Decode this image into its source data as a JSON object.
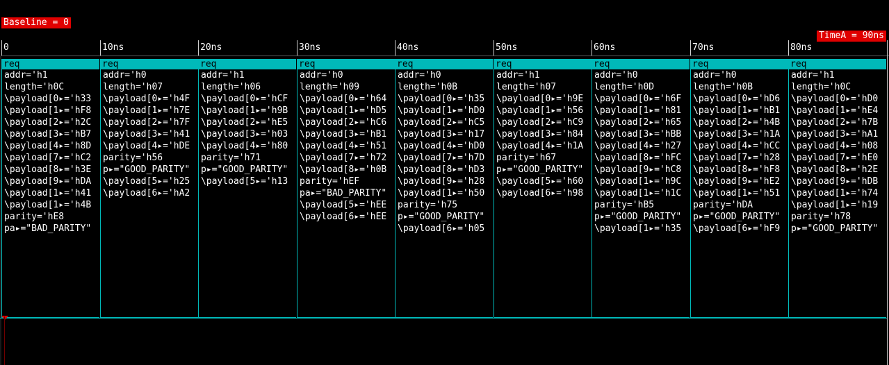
{
  "baseline_label": "Baseline = 0",
  "timea_label": "TimeA = 90ns",
  "ruler_ticks": [
    "0",
    "10ns",
    "20ns",
    "30ns",
    "40ns",
    "50ns",
    "60ns",
    "70ns",
    "80ns"
  ],
  "colors": {
    "background": "#000000",
    "transaction": "#00b9b9",
    "marker": "#e00000",
    "text": "#ffffff"
  },
  "transactions": [
    {
      "label": "req",
      "lines": [
        "addr='h1",
        "length='h0C",
        "\\payload[0▸='h33",
        "\\payload[1▸='hF8",
        "\\payload[2▸='h2C",
        "\\payload[3▸='hB7",
        "\\payload[4▸='h8D",
        "\\payload[7▸='hC2",
        "\\payload[8▸='h3E",
        "\\payload[9▸='hDA",
        "\\payload[1▸='h41",
        "\\payload[1▸='h4B",
        "parity='hE8",
        "pa▸=\"BAD_PARITY\""
      ]
    },
    {
      "label": "req",
      "lines": [
        "addr='h0",
        "length='h07",
        "\\payload[0▸='h4F",
        "\\payload[1▸='h7E",
        "\\payload[2▸='h7F",
        "\\payload[3▸='h41",
        "\\payload[4▸='hDE",
        "parity='h56",
        "p▸=\"GOOD_PARITY\"",
        "\\payload[5▸='h25",
        "\\payload[6▸='hA2"
      ]
    },
    {
      "label": "req",
      "lines": [
        "addr='h1",
        "length='h06",
        "\\payload[0▸='hCF",
        "\\payload[1▸='h9B",
        "\\payload[2▸='hE5",
        "\\payload[3▸='h03",
        "\\payload[4▸='h80",
        "parity='h71",
        "p▸=\"GOOD_PARITY\"",
        "\\payload[5▸='h13"
      ]
    },
    {
      "label": "req",
      "lines": [
        "addr='h0",
        "length='h09",
        "\\payload[0▸='h64",
        "\\payload[1▸='hD5",
        "\\payload[2▸='hC6",
        "\\payload[3▸='hB1",
        "\\payload[4▸='h51",
        "\\payload[7▸='h72",
        "\\payload[8▸='h0B",
        "parity='hEF",
        "pa▸=\"BAD_PARITY\"",
        "\\payload[5▸='hEE",
        "\\payload[6▸='hEE"
      ]
    },
    {
      "label": "req",
      "lines": [
        "addr='h0",
        "length='h0B",
        "\\payload[0▸='h35",
        "\\payload[1▸='hD0",
        "\\payload[2▸='hC5",
        "\\payload[3▸='h17",
        "\\payload[4▸='hD0",
        "\\payload[7▸='h7D",
        "\\payload[8▸='hD3",
        "\\payload[9▸='h28",
        "\\payload[1▸='h50",
        "parity='h75",
        "p▸=\"GOOD_PARITY\"",
        "\\payload[6▸='h05"
      ]
    },
    {
      "label": "req",
      "lines": [
        "addr='h1",
        "length='h07",
        "\\payload[0▸='h9E",
        "\\payload[1▸='h56",
        "\\payload[2▸='hC9",
        "\\payload[3▸='h84",
        "\\payload[4▸='h1A",
        "parity='h67",
        "p▸=\"GOOD_PARITY\"",
        "\\payload[5▸='h60",
        "\\payload[6▸='h98"
      ]
    },
    {
      "label": "req",
      "lines": [
        "addr='h0",
        "length='h0D",
        "\\payload[0▸='h6F",
        "\\payload[1▸='h81",
        "\\payload[2▸='h65",
        "\\payload[3▸='hBB",
        "\\payload[4▸='h27",
        "\\payload[8▸='hFC",
        "\\payload[9▸='hC8",
        "\\payload[1▸='h9C",
        "\\payload[1▸='h1C",
        "parity='hB5",
        "p▸=\"GOOD_PARITY\"",
        "\\payload[1▸='h35"
      ]
    },
    {
      "label": "req",
      "lines": [
        "addr='h0",
        "length='h0B",
        "\\payload[0▸='hD6",
        "\\payload[1▸='hB1",
        "\\payload[2▸='h4B",
        "\\payload[3▸='h1A",
        "\\payload[4▸='hCC",
        "\\payload[7▸='h28",
        "\\payload[8▸='hF8",
        "\\payload[9▸='hE2",
        "\\payload[1▸='h51",
        "parity='hDA",
        "p▸=\"GOOD_PARITY\"",
        "\\payload[6▸='hF9"
      ]
    },
    {
      "label": "req",
      "lines": [
        "addr='h1",
        "length='h0C",
        "\\payload[0▸='hD0",
        "\\payload[1▸='hE4",
        "\\payload[2▸='h7B",
        "\\payload[3▸='hA1",
        "\\payload[4▸='h08",
        "\\payload[7▸='hE0",
        "\\payload[8▸='h2E",
        "\\payload[9▸='hDB",
        "\\payload[1▸='h74",
        "\\payload[1▸='h19",
        "parity='h78",
        "p▸=\"GOOD_PARITY\""
      ]
    }
  ]
}
